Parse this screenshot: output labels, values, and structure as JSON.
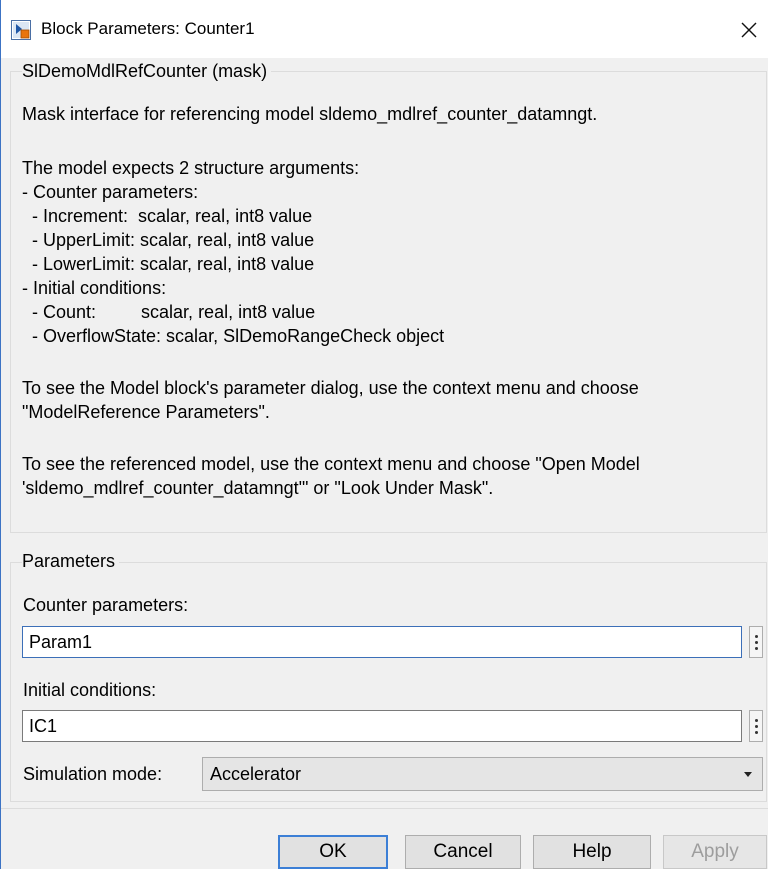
{
  "window": {
    "title": "Block Parameters: Counter1",
    "app_icon": "simulink-block-icon",
    "close_icon": "close-icon"
  },
  "mask_group": {
    "label": "SlDemoMdlRefCounter (mask)",
    "description_lines": [
      "Mask interface for referencing model sldemo_mdlref_counter_datamngt.",
      "",
      "The model expects 2 structure arguments:",
      "- Counter parameters:",
      "  - Increment:  scalar, real, int8 value",
      "  - UpperLimit: scalar, real, int8 value",
      "  - LowerLimit: scalar, real, int8 value",
      "- Initial conditions:",
      "  - Count:         scalar, real, int8 value",
      "  - OverflowState: scalar, SlDemoRangeCheck object",
      "",
      "To see the Model block's parameter dialog, use the context menu and choose",
      "\"ModelReference Parameters\".",
      "",
      "To see the referenced model, use the context menu and choose \"Open Model",
      "'sldemo_mdlref_counter_datamngt'\" or \"Look Under Mask\"."
    ]
  },
  "parameters_group": {
    "label": "Parameters",
    "counter_parameters": {
      "label": "Counter parameters:",
      "value": "Param1"
    },
    "initial_conditions": {
      "label": "Initial conditions:",
      "value": "IC1"
    },
    "simulation_mode": {
      "label": "Simulation mode:",
      "selected": "Accelerator"
    }
  },
  "buttons": {
    "ok": "OK",
    "cancel": "Cancel",
    "help": "Help",
    "apply": "Apply"
  },
  "colors": {
    "accent": "#3c7fd6",
    "dialog_bg": "#f0f0f0",
    "disabled_text": "#9d9d9d"
  }
}
